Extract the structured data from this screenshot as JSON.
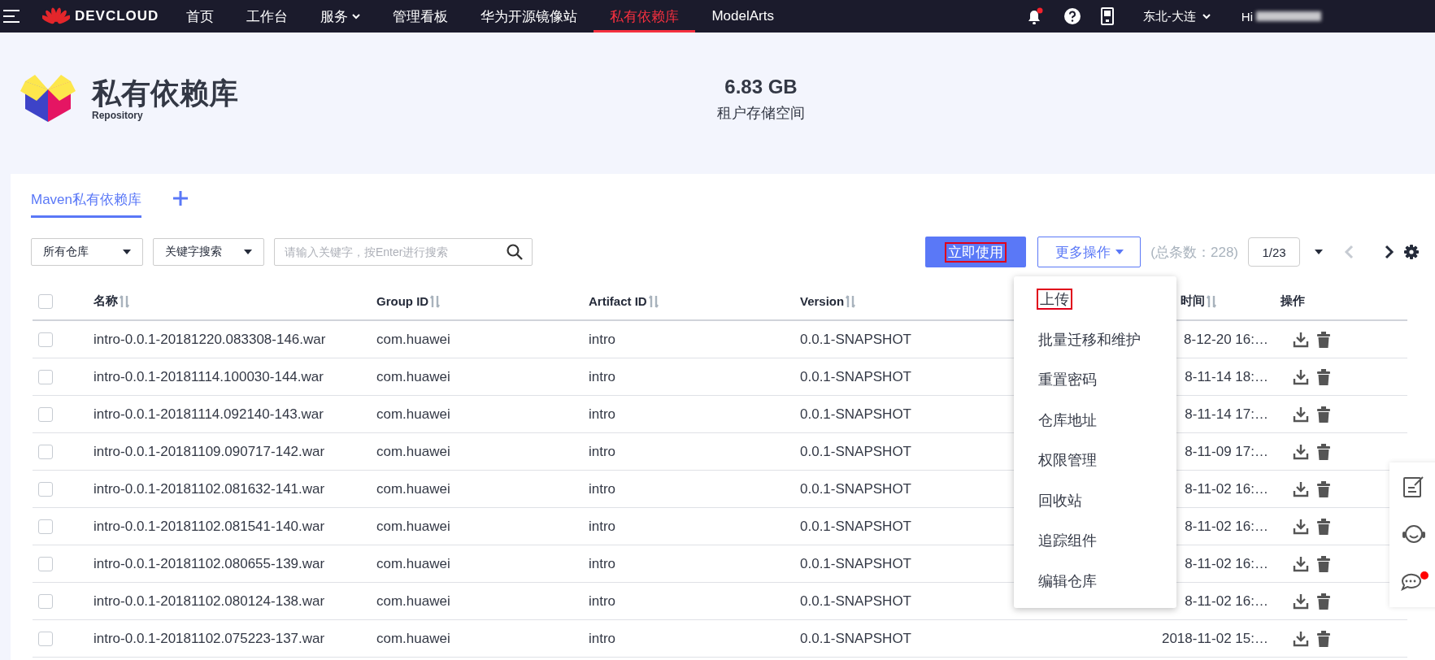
{
  "nav": {
    "brand": "DEVCLOUD",
    "items": [
      {
        "label": "首页",
        "selected": false,
        "has_dropdown": false
      },
      {
        "label": "工作台",
        "selected": false,
        "has_dropdown": false
      },
      {
        "label": "服务",
        "selected": false,
        "has_dropdown": true
      },
      {
        "label": "管理看板",
        "selected": false,
        "has_dropdown": false
      },
      {
        "label": "华为开源镜像站",
        "selected": false,
        "has_dropdown": false
      },
      {
        "label": "私有依赖库",
        "selected": true,
        "has_dropdown": false
      },
      {
        "label": "ModelArts",
        "selected": false,
        "has_dropdown": false
      }
    ],
    "notification_dot": true,
    "region": "东北-大连",
    "greeting": "Hi"
  },
  "header": {
    "title": "私有依赖库",
    "subtitle": "Repository",
    "storage_value": "6.83 GB",
    "storage_label": "租户存储空间"
  },
  "tabs": [
    {
      "label": "Maven私有依赖库",
      "selected": true
    }
  ],
  "filters": {
    "repo_select": "所有仓库",
    "search_type_select": "关键字搜索",
    "search_placeholder": "请输入关键字，按Enter进行搜索"
  },
  "toolbar": {
    "primary_button": {
      "label": "立即使用",
      "highlighted": true
    },
    "more_button": "更多操作",
    "total": "(总条数：228)",
    "page": "1/23"
  },
  "table": {
    "columns": [
      {
        "label": "名称",
        "sortable": true
      },
      {
        "label": "Group ID",
        "sortable": true
      },
      {
        "label": "Artifact ID",
        "sortable": true
      },
      {
        "label": "Version",
        "sortable": true
      },
      {
        "label": "时间",
        "sortable": true
      },
      {
        "label": "操作",
        "sortable": false
      }
    ],
    "select_all_checked": false,
    "rows": [
      {
        "checked": false,
        "name": "intro-0.0.1-20181220.083308-146.war",
        "group_id": "com.huawei",
        "artifact_id": "intro",
        "version": "0.0.1-SNAPSHOT",
        "time": "8-12-20 16:…"
      },
      {
        "checked": false,
        "name": "intro-0.0.1-20181114.100030-144.war",
        "group_id": "com.huawei",
        "artifact_id": "intro",
        "version": "0.0.1-SNAPSHOT",
        "time": "8-11-14 18:…"
      },
      {
        "checked": false,
        "name": "intro-0.0.1-20181114.092140-143.war",
        "group_id": "com.huawei",
        "artifact_id": "intro",
        "version": "0.0.1-SNAPSHOT",
        "time": "8-11-14 17:…"
      },
      {
        "checked": false,
        "name": "intro-0.0.1-20181109.090717-142.war",
        "group_id": "com.huawei",
        "artifact_id": "intro",
        "version": "0.0.1-SNAPSHOT",
        "time": "8-11-09 17:…"
      },
      {
        "checked": false,
        "name": "intro-0.0.1-20181102.081632-141.war",
        "group_id": "com.huawei",
        "artifact_id": "intro",
        "version": "0.0.1-SNAPSHOT",
        "time": "8-11-02 16:…"
      },
      {
        "checked": false,
        "name": "intro-0.0.1-20181102.081541-140.war",
        "group_id": "com.huawei",
        "artifact_id": "intro",
        "version": "0.0.1-SNAPSHOT",
        "time": "8-11-02 16:…"
      },
      {
        "checked": false,
        "name": "intro-0.0.1-20181102.080655-139.war",
        "group_id": "com.huawei",
        "artifact_id": "intro",
        "version": "0.0.1-SNAPSHOT",
        "time": "8-11-02 16:…"
      },
      {
        "checked": false,
        "name": "intro-0.0.1-20181102.080124-138.war",
        "group_id": "com.huawei",
        "artifact_id": "intro",
        "version": "0.0.1-SNAPSHOT",
        "time": "8-11-02 16:…"
      },
      {
        "checked": false,
        "name": "intro-0.0.1-20181102.075223-137.war",
        "group_id": "com.huawei",
        "artifact_id": "intro",
        "version": "0.0.1-SNAPSHOT",
        "time": "2018-11-02 15:…"
      }
    ]
  },
  "menu": {
    "items": [
      {
        "label": "上传",
        "highlighted": true
      },
      {
        "label": "批量迁移和维护",
        "highlighted": false
      },
      {
        "label": "重置密码",
        "highlighted": false
      },
      {
        "label": "仓库地址",
        "highlighted": false
      },
      {
        "label": "权限管理",
        "highlighted": false
      },
      {
        "label": "回收站",
        "highlighted": false
      },
      {
        "label": "追踪组件",
        "highlighted": false
      },
      {
        "label": "编辑仓库",
        "highlighted": false
      }
    ]
  },
  "side_panel": {
    "chat_dot": true
  }
}
